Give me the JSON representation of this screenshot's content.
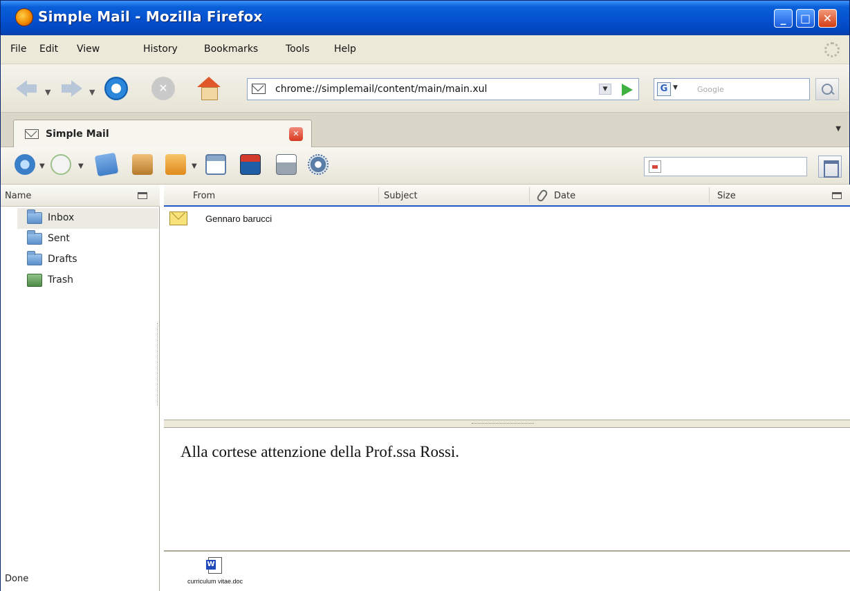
{
  "window": {
    "title": "Simple Mail - Mozilla Firefox",
    "controls": {
      "minimize": "_",
      "maximize": "□",
      "close": "✕"
    }
  },
  "menu": {
    "items": [
      "File",
      "Edit",
      "View",
      "History",
      "Bookmarks",
      "Tools",
      "Help"
    ]
  },
  "navigation": {
    "url": "chrome://simplemail/content/main/main.xul",
    "search_engine_letter": "G",
    "search_placeholder": "Google",
    "stop_glyph": "✕"
  },
  "tabs": {
    "active_label": "Simple Mail",
    "close_glyph": "✕"
  },
  "folders": {
    "header": "Name",
    "items": [
      {
        "label": "Inbox",
        "icon": "folder-icon",
        "selected": true
      },
      {
        "label": "Sent",
        "icon": "folder-icon",
        "selected": false
      },
      {
        "label": "Drafts",
        "icon": "folder-icon",
        "selected": false
      },
      {
        "label": "Trash",
        "icon": "trash-icon",
        "selected": false
      }
    ]
  },
  "message_list": {
    "columns": {
      "from": "From",
      "subject": "Subject",
      "date": "Date",
      "size": "Size"
    },
    "messages": [
      {
        "from": "Gennaro barucci",
        "icon": "envelope-icon"
      }
    ]
  },
  "preview": {
    "body": "Alla cortese attenzione della Prof.ssa Rossi."
  },
  "attachments": [
    {
      "name": "curriculum vitae.doc",
      "icon": "word-doc-icon"
    }
  ],
  "status": {
    "text": "Done"
  },
  "colors": {
    "titlebar": "#0551d0",
    "selection_border": "#1c58c8",
    "window_bg": "#ece9d8"
  }
}
